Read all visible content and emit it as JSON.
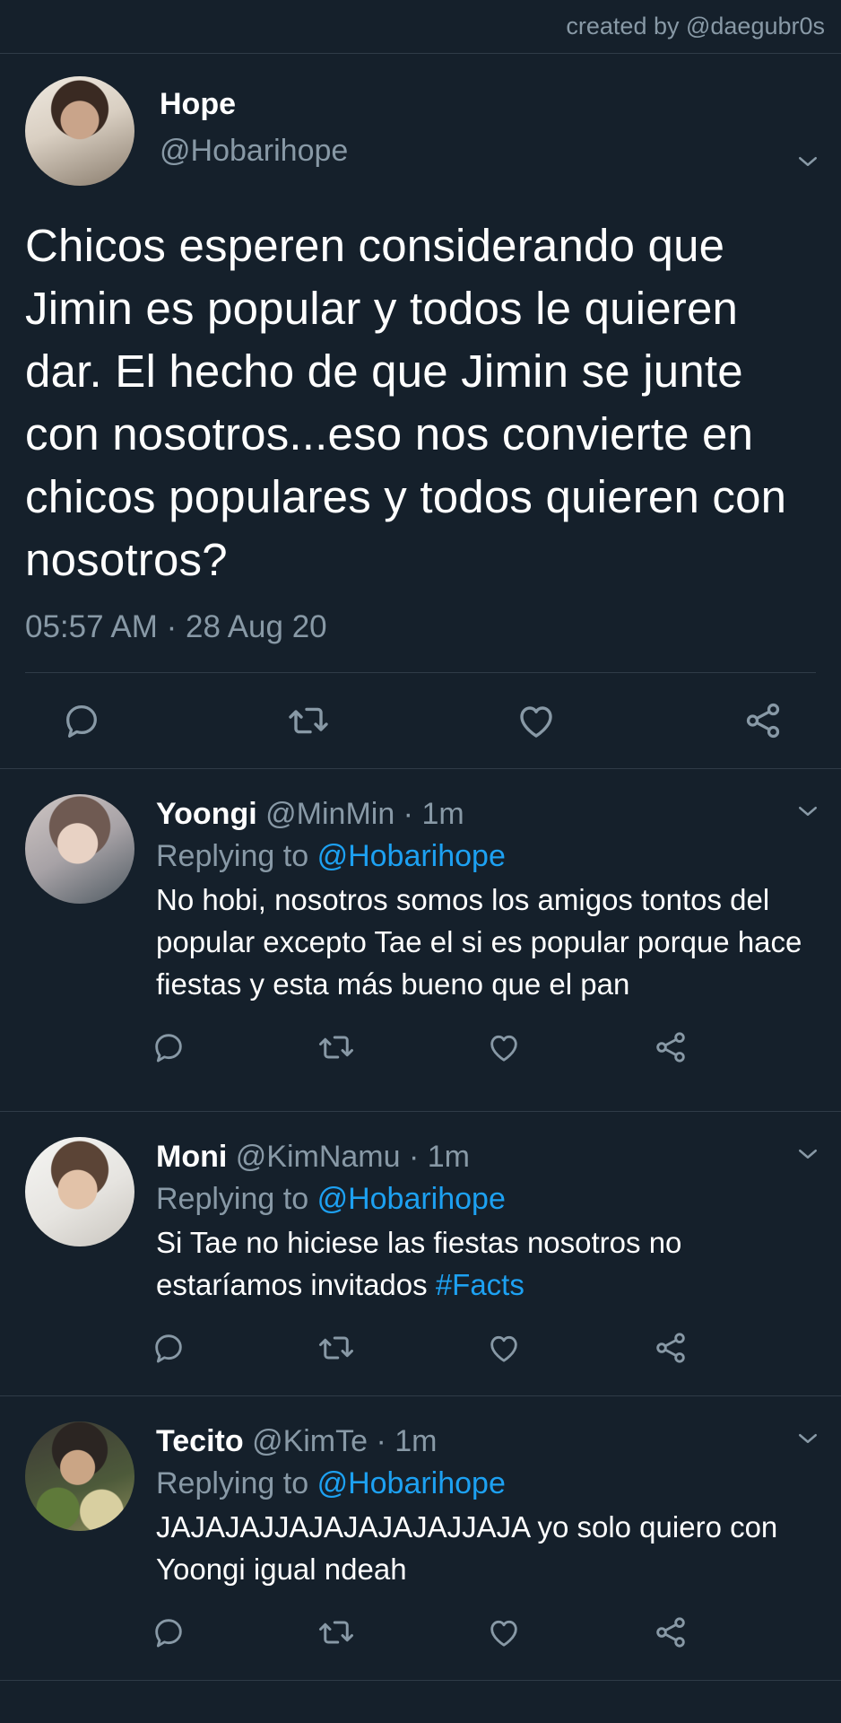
{
  "header": {
    "credit": "created by @daegubr0s"
  },
  "main_tweet": {
    "name": "Hope",
    "handle": "@Hobarihope",
    "text": "Chicos esperen considerando que Jimin es popular y todos le quieren dar. El hecho de que Jimin se junte con nosotros...eso nos convierte en chicos populares y todos quieren con nosotros?",
    "timestamp": "05:57 AM · 28 Aug 20"
  },
  "replies": [
    {
      "name": "Yoongi",
      "meta": "@MinMin · 1m",
      "replying_label": "Replying to",
      "replying_to": "@Hobarihope",
      "text": "No hobi, nosotros somos los amigos tontos del popular excepto Tae el si es popular porque hace fiestas y esta más bueno que el pan",
      "hashtag": ""
    },
    {
      "name": "Moni",
      "meta": "@KimNamu · 1m",
      "replying_label": "Replying to",
      "replying_to": "@Hobarihope",
      "text": "Si Tae no hiciese las fiestas nosotros no estaríamos invitados ",
      "hashtag": "#Facts"
    },
    {
      "name": "Tecito",
      "meta": "@KimTe · 1m",
      "replying_label": "Replying to",
      "replying_to": "@Hobarihope",
      "text": "JAJAJAJJAJAJAJAJAJJAJA yo solo quiero con Yoongi igual ndeah",
      "hashtag": ""
    }
  ],
  "icons": {
    "reply": "reply-icon",
    "retweet": "retweet-icon",
    "like": "heart-icon",
    "share": "share-icon",
    "menu": "chevron-down-icon"
  },
  "colors": {
    "background": "#15202b",
    "secondary_text": "#8899a6",
    "accent": "#1da1f2",
    "divider": "#2f3b47"
  }
}
